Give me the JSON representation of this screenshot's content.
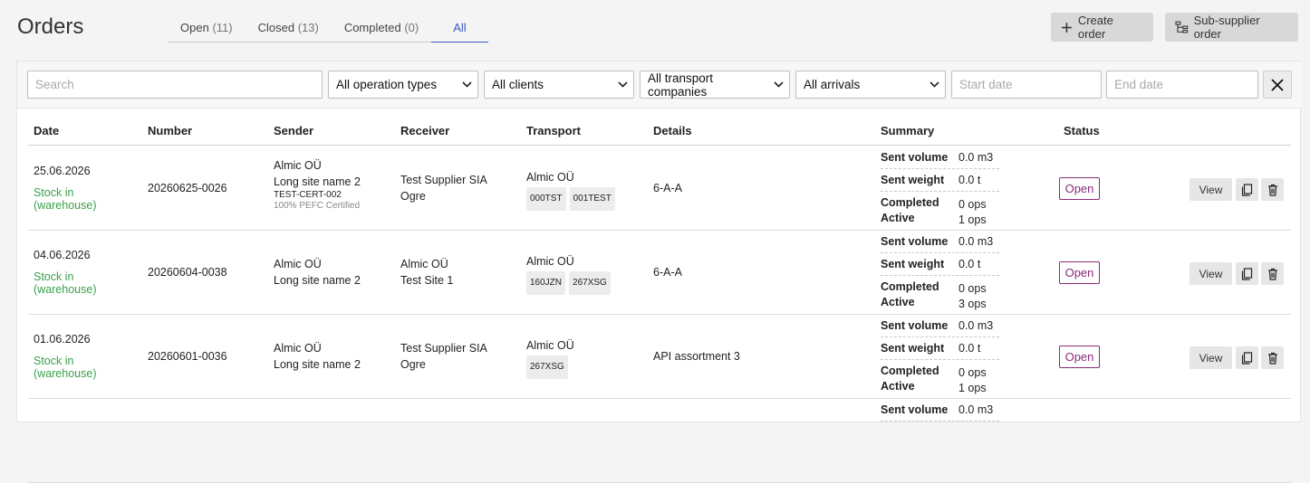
{
  "page": {
    "title": "Orders"
  },
  "tabs": [
    {
      "label": "Open",
      "count": "(11)"
    },
    {
      "label": "Closed",
      "count": "(13)"
    },
    {
      "label": "Completed",
      "count": "(0)"
    },
    {
      "label": "All",
      "count": ""
    }
  ],
  "actions": {
    "create_order": "Create order",
    "sub_supplier_order": "Sub-supplier order"
  },
  "filters": {
    "search_placeholder": "Search",
    "operation_types": "All operation types",
    "clients": "All clients",
    "transport_companies": "All transport companies",
    "arrivals": "All arrivals",
    "start_date_placeholder": "Start date",
    "end_date_placeholder": "End date"
  },
  "columns": {
    "date": "Date",
    "number": "Number",
    "sender": "Sender",
    "receiver": "Receiver",
    "transport": "Transport",
    "details": "Details",
    "summary": "Summary",
    "status": "Status"
  },
  "summary_labels": {
    "sent_volume": "Sent volume",
    "sent_weight": "Sent weight",
    "completed": "Completed",
    "active": "Active"
  },
  "row_actions": {
    "view": "View"
  },
  "rows": [
    {
      "date": "25.06.2026",
      "stock_line1": "Stock in",
      "stock_line2": "(warehouse)",
      "number": "20260625-0026",
      "sender_name": "Almic OÜ",
      "sender_site": "Long site name 2",
      "sender_cert": "TEST-CERT-002",
      "sender_cert_desc": "100% PEFC Certified",
      "receiver_name": "Test Supplier SIA",
      "receiver_site": "Ogre",
      "transport_company": "Almic OÜ",
      "plates": [
        "000TST",
        "001TEST"
      ],
      "details": "6-A-A",
      "sent_volume": "0.0 m3",
      "sent_weight": "0.0 t",
      "completed": "0 ops",
      "active": "1 ops",
      "status": "Open"
    },
    {
      "date": "04.06.2026",
      "stock_line1": "Stock in",
      "stock_line2": "(warehouse)",
      "number": "20260604-0038",
      "sender_name": "Almic OÜ",
      "sender_site": "Long site name 2",
      "sender_cert": "",
      "sender_cert_desc": "",
      "receiver_name": "Almic OÜ",
      "receiver_site": "Test Site 1",
      "transport_company": "Almic OÜ",
      "plates": [
        "160JZN",
        "267XSG"
      ],
      "details": "6-A-A",
      "sent_volume": "0.0 m3",
      "sent_weight": "0.0 t",
      "completed": "0 ops",
      "active": "3 ops",
      "status": "Open"
    },
    {
      "date": "01.06.2026",
      "stock_line1": "Stock in",
      "stock_line2": "(warehouse)",
      "number": "20260601-0036",
      "sender_name": "Almic OÜ",
      "sender_site": "Long site name 2",
      "sender_cert": "",
      "sender_cert_desc": "",
      "receiver_name": "Test Supplier SIA",
      "receiver_site": "Ogre",
      "transport_company": "Almic OÜ",
      "plates": [
        "267XSG"
      ],
      "details": "API assortment 3",
      "sent_volume": "0.0 m3",
      "sent_weight": "0.0 t",
      "completed": "0 ops",
      "active": "1 ops",
      "status": "Open"
    },
    {
      "date": "",
      "stock_line1": "",
      "stock_line2": "",
      "number": "",
      "sender_name": "",
      "sender_site": "",
      "sender_cert": "",
      "sender_cert_desc": "",
      "receiver_name": "",
      "receiver_site": "",
      "transport_company": "",
      "plates": [],
      "details": "",
      "sent_volume": "0.0 m3",
      "sent_weight": "",
      "completed": "",
      "active": "",
      "status": ""
    }
  ]
}
